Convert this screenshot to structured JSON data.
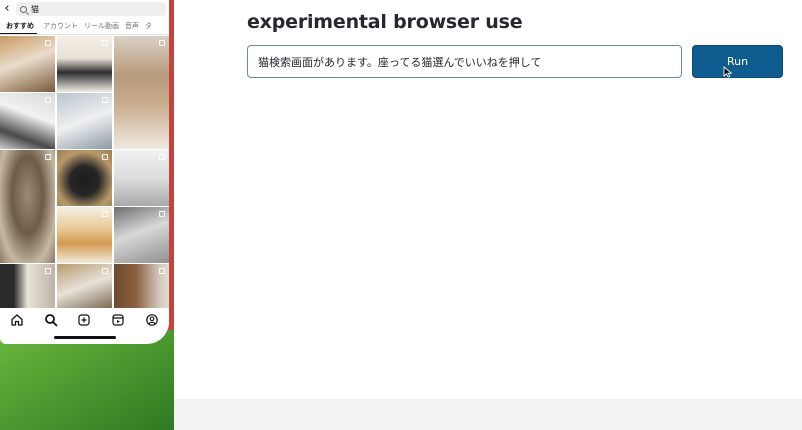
{
  "phone": {
    "search": {
      "query": "猫"
    },
    "tabs": [
      "おすすめ",
      "アカウント",
      "リール動画",
      "音声",
      "タ"
    ],
    "grid_tile_count": 16,
    "bottom_nav": [
      "home-icon",
      "search-icon",
      "create-icon",
      "reels-icon",
      "profile-icon"
    ]
  },
  "app": {
    "title": "experimental browser use",
    "task_input": {
      "value": "猫検索画面があります。座ってる猫選んでいいねを押して"
    },
    "run_label": "Run",
    "colors": {
      "run_button": "#0f5c91",
      "title": "#262730",
      "input_border": "#6b8ba4"
    }
  }
}
